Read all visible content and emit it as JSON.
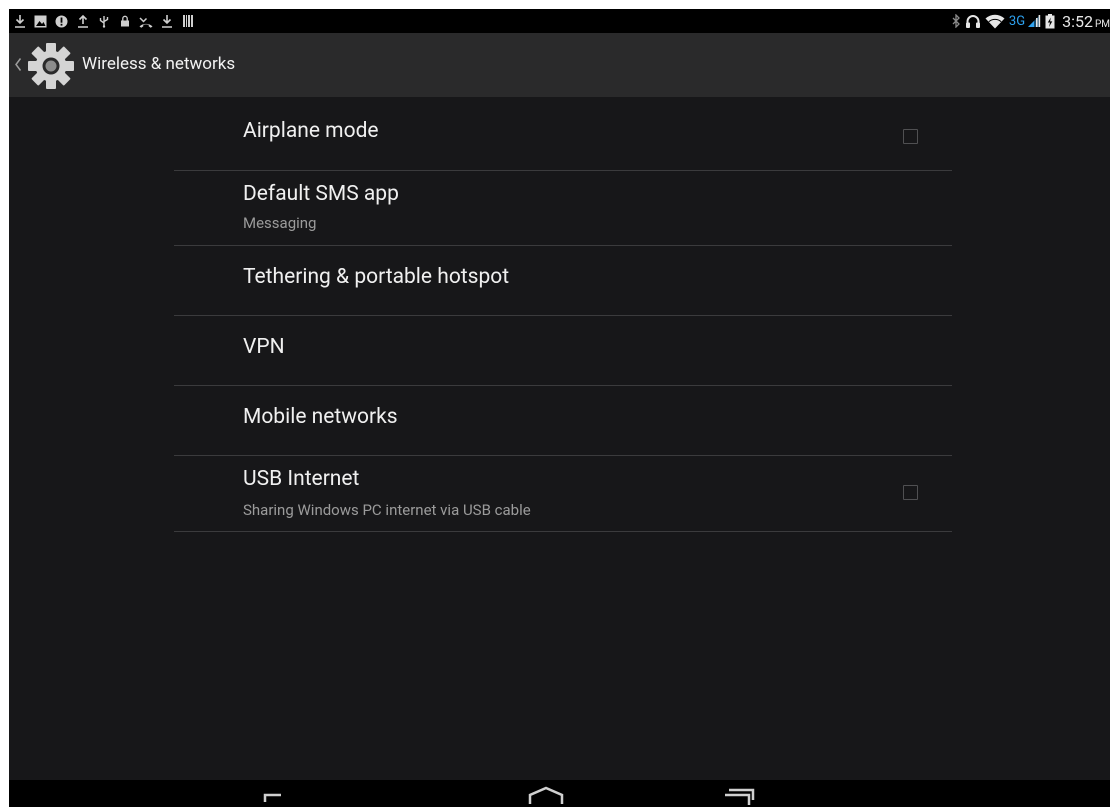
{
  "status_bar": {
    "notification_icons": [
      "download-icon",
      "gallery-icon",
      "alert-icon",
      "upload-icon",
      "usb-icon",
      "lock-icon",
      "missed-call-icon",
      "download-icon",
      "barcode-icon"
    ],
    "system_icons": [
      "bluetooth-icon",
      "headset-icon",
      "wifi-icon",
      "signal-icon",
      "battery-icon"
    ],
    "network_type": "3G",
    "time": "3:52",
    "ampm": "PM"
  },
  "action_bar": {
    "title": "Wireless & networks",
    "icon": "settings-gear-icon"
  },
  "settings": [
    {
      "title": "Airplane mode",
      "summary": "",
      "checkbox": true,
      "checked": false
    },
    {
      "title": "Default SMS app",
      "summary": "Messaging",
      "checkbox": false
    },
    {
      "title": "Tethering & portable hotspot",
      "summary": "",
      "checkbox": false
    },
    {
      "title": "VPN",
      "summary": "",
      "checkbox": false
    },
    {
      "title": "Mobile networks",
      "summary": "",
      "checkbox": false
    },
    {
      "title": "USB Internet",
      "summary": "Sharing Windows PC internet via USB cable",
      "checkbox": true,
      "checked": false
    }
  ],
  "nav_bar": [
    "back-icon",
    "home-icon",
    "recents-icon"
  ],
  "colors": {
    "background": "#171719",
    "action_bar": "#2a2a2b",
    "accent": "#2ea3f2",
    "divider": "#3b3b3d"
  }
}
